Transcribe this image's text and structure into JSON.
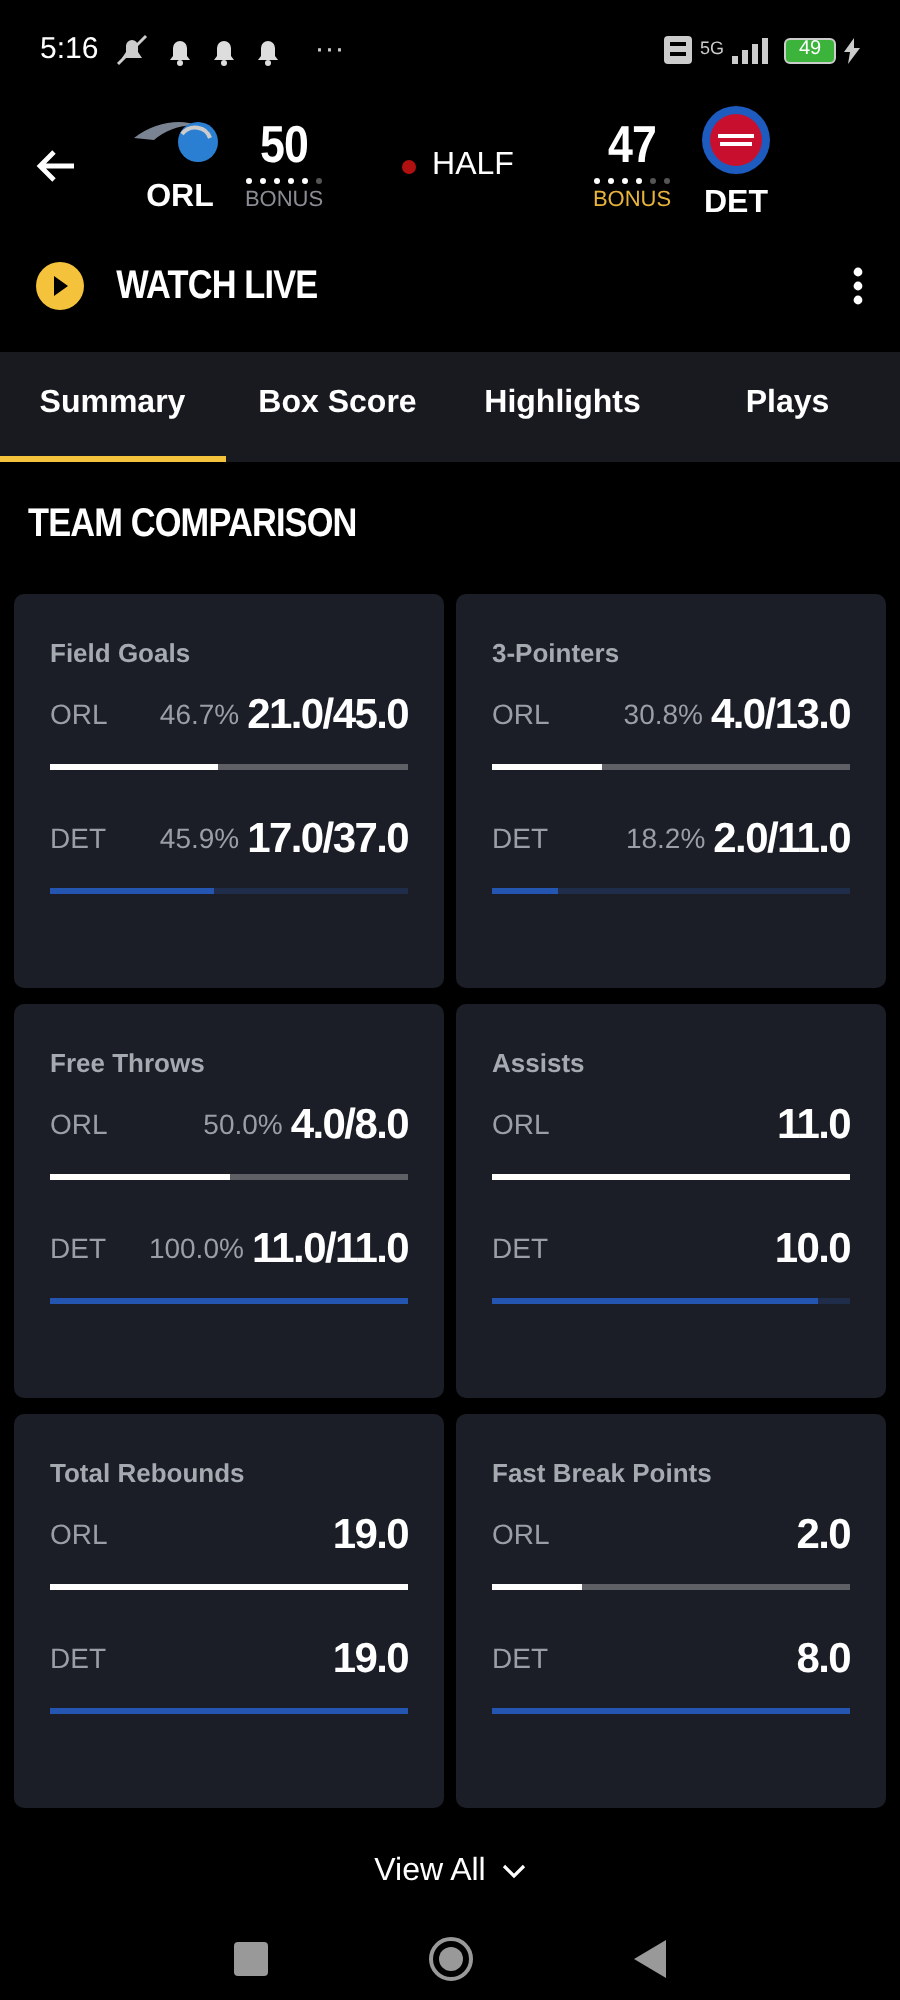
{
  "status_bar": {
    "time": "5:16",
    "more": "···",
    "network": "5G",
    "battery": "49"
  },
  "game": {
    "teams": [
      {
        "abbr": "ORL",
        "score": "50",
        "bonus": "BONUS",
        "bonus_active": false,
        "fouls": [
          true,
          true,
          true,
          true,
          true,
          false
        ]
      },
      {
        "abbr": "DET",
        "score": "47",
        "bonus": "BONUS",
        "bonus_active": true,
        "fouls": [
          true,
          true,
          true,
          true,
          false,
          false
        ]
      }
    ],
    "period": "HALF",
    "live": true
  },
  "watch": {
    "label": "WATCH LIVE"
  },
  "tabs": [
    {
      "label": "Summary",
      "selected": true
    },
    {
      "label": "Box Score",
      "selected": false
    },
    {
      "label": "Highlights",
      "selected": false
    },
    {
      "label": "Plays",
      "selected": false
    }
  ],
  "section_title": "TEAM COMPARISON",
  "stats": [
    {
      "title": "Field Goals",
      "rows": [
        {
          "team": "ORL",
          "pct": "46.7%",
          "value": "21.0/45.0",
          "level": 0.467,
          "color": "#ffffff"
        },
        {
          "team": "DET",
          "pct": "45.9%",
          "value": "17.0/37.0",
          "level": 0.459,
          "color": "#2455b0"
        }
      ]
    },
    {
      "title": "3-Pointers",
      "rows": [
        {
          "team": "ORL",
          "pct": "30.8%",
          "value": "4.0/13.0",
          "level": 0.308,
          "color": "#ffffff"
        },
        {
          "team": "DET",
          "pct": "18.2%",
          "value": "2.0/11.0",
          "level": 0.182,
          "color": "#2455b0"
        }
      ]
    },
    {
      "title": "Free Throws",
      "rows": [
        {
          "team": "ORL",
          "pct": "50.0%",
          "value": "4.0/8.0",
          "level": 0.5,
          "color": "#ffffff"
        },
        {
          "team": "DET",
          "pct": "100.0%",
          "value": "11.0/11.0",
          "level": 1,
          "color": "#2455b0"
        }
      ]
    },
    {
      "title": "Assists",
      "rows": [
        {
          "team": "ORL",
          "value": "11.0",
          "level": 1,
          "color": "#ffffff"
        },
        {
          "team": "DET",
          "value": "10.0",
          "level": 0.91,
          "color": "#2455b0"
        }
      ]
    },
    {
      "title": "Total Rebounds",
      "rows": [
        {
          "team": "ORL",
          "value": "19.0",
          "level": 1,
          "color": "#ffffff"
        },
        {
          "team": "DET",
          "value": "19.0",
          "level": 1,
          "color": "#2455b0"
        }
      ]
    },
    {
      "title": "Fast Break Points",
      "rows": [
        {
          "team": "ORL",
          "value": "2.0",
          "level": 0.25,
          "color": "#ffffff"
        },
        {
          "team": "DET",
          "value": "8.0",
          "level": 1,
          "color": "#2455b0"
        }
      ]
    }
  ],
  "view_all": "View All"
}
